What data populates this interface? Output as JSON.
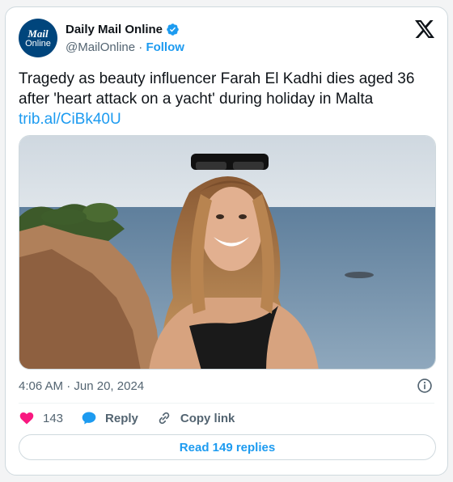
{
  "author": {
    "avatar_line1": "Mail",
    "avatar_line2": "Online",
    "name": "Daily Mail Online",
    "handle": "@MailOnline",
    "separator": "·",
    "follow_label": "Follow"
  },
  "tweet": {
    "text": "Tragedy as beauty influencer Farah El Kadhi dies aged 36 after 'heart attack on a yacht' during holiday in Malta",
    "link": "trib.al/CiBk40U",
    "time": "4:06 AM",
    "date_sep": "·",
    "date": "Jun 20, 2024"
  },
  "actions": {
    "like_count": "143",
    "reply_label": "Reply",
    "copy_label": "Copy link",
    "read_replies_label": "Read 149 replies"
  },
  "colors": {
    "accent": "#1d9bf0",
    "like": "#f91880",
    "brand": "#00457c"
  },
  "icons": [
    "verified-badge-icon",
    "x-logo-icon",
    "info-icon",
    "heart-icon",
    "reply-bubble-icon",
    "link-icon"
  ]
}
